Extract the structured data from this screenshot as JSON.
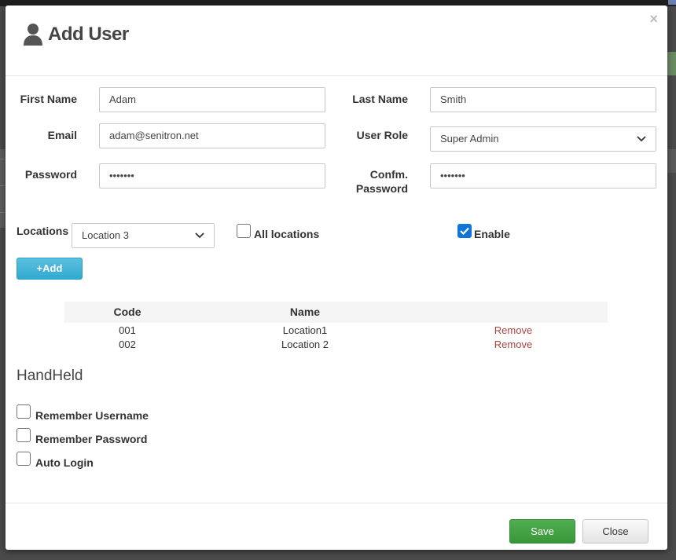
{
  "dialog": {
    "title": "Add User",
    "close_symbol": "×"
  },
  "form": {
    "first_name_label": "First Name",
    "first_name_value": "Adam",
    "last_name_label": "Last Name",
    "last_name_value": "Smith",
    "email_label": "Email",
    "email_value": "adam@senitron.net",
    "user_role_label": "User Role",
    "user_role_value": "Super Admin",
    "password_label": "Password",
    "password_value": "•••••••",
    "confirm_password_label_1": "Confm.",
    "confirm_password_label_2": "Password",
    "confirm_password_value": "•••••••",
    "locations_label": "Locations",
    "locations_value": "Location 3",
    "all_locations_label": "All locations",
    "all_locations_checked": false,
    "enable_label": "Enable",
    "enable_checked": true,
    "add_button_label": "+Add"
  },
  "locations_table": {
    "headers": [
      "Code",
      "Name",
      ""
    ],
    "rows": [
      {
        "code": "001",
        "name": "Location1",
        "action": "Remove"
      },
      {
        "code": "002",
        "name": "Location 2",
        "action": "Remove"
      }
    ]
  },
  "handheld": {
    "title": "HandHeld",
    "options": [
      {
        "label": "Remember Username",
        "checked": false
      },
      {
        "label": "Remember Password",
        "checked": false
      },
      {
        "label": "Auto Login",
        "checked": false
      }
    ]
  },
  "footer": {
    "save_label": "Save",
    "close_label": "Close"
  },
  "colors": {
    "add_button": "#5bc0de",
    "save_button": "#449d44",
    "remove_link": "#a94442",
    "checkbox_checked": "#0f75d8"
  },
  "icons": {
    "title_icon": "user-icon",
    "select_arrow": "chevron-down-icon",
    "check": "check-icon"
  }
}
